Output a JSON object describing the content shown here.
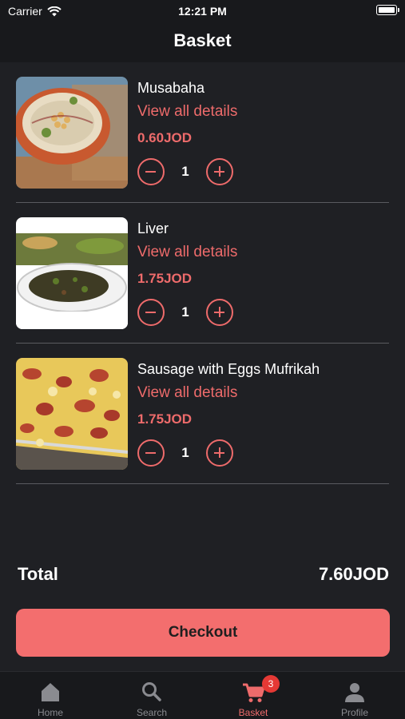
{
  "status_bar": {
    "carrier": "Carrier",
    "time": "12:21 PM"
  },
  "header": {
    "title": "Basket"
  },
  "items": [
    {
      "name": "Musabaha",
      "details_link": "View all details",
      "price": "0.60JOD",
      "quantity": "1"
    },
    {
      "name": "Liver",
      "details_link": "View all details",
      "price": "1.75JOD",
      "quantity": "1"
    },
    {
      "name": "Sausage  with Eggs Mufrikah",
      "details_link": "View all details",
      "price": "1.75JOD",
      "quantity": "1"
    }
  ],
  "total": {
    "label": "Total",
    "value": "7.60JOD"
  },
  "checkout": {
    "label": "Checkout"
  },
  "tab_bar": {
    "tabs": [
      {
        "label": "Home",
        "icon": "home-icon"
      },
      {
        "label": "Search",
        "icon": "search-icon"
      },
      {
        "label": "Basket",
        "icon": "cart-icon",
        "badge": "3"
      },
      {
        "label": "Profile",
        "icon": "person-icon"
      }
    ],
    "active": "Basket"
  },
  "colors": {
    "accent": "#ee6b6b",
    "button": "#f36e6e",
    "background": "#1f2024",
    "bar": "#18191c",
    "badge": "#e53935"
  }
}
